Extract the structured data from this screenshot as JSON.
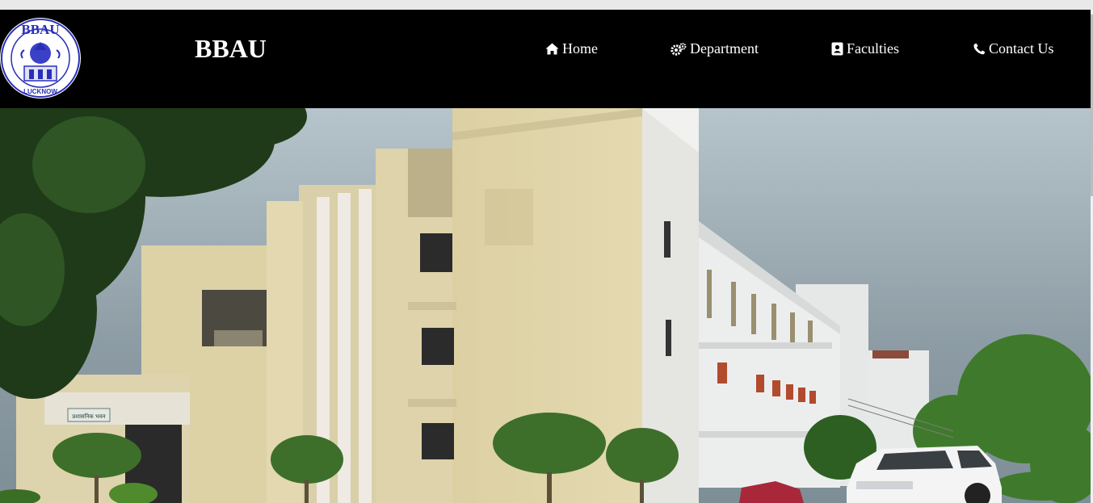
{
  "header": {
    "site_title": "BBAU",
    "logo": {
      "top_text": "BBAU",
      "bottom_text": "LUCKNOW",
      "color": "#2a2fb8"
    }
  },
  "nav": {
    "items": [
      {
        "label": "Home",
        "icon": "home-icon"
      },
      {
        "label": "Department",
        "icon": "gears-icon"
      },
      {
        "label": "Faculties",
        "icon": "address-book-icon"
      },
      {
        "label": "Contact Us",
        "icon": "phone-icon"
      }
    ]
  },
  "hero": {
    "kind": "campus building photo",
    "building_sign": "प्रशासनिक भवन"
  },
  "colors": {
    "header_bg": "#000000",
    "nav_text": "#ffffff",
    "sky": "#a9b6bd",
    "building": "#ddd2a8"
  }
}
